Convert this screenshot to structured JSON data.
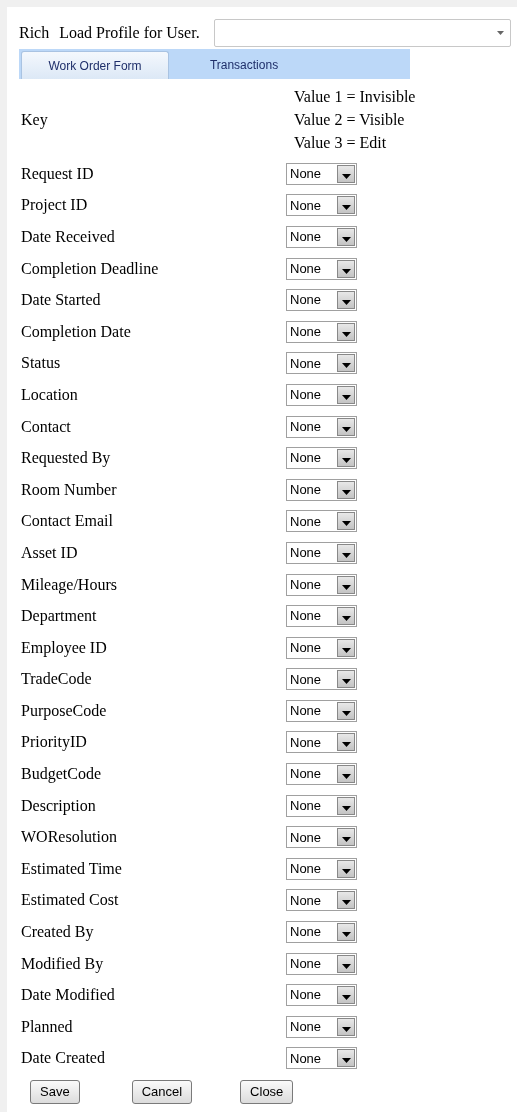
{
  "header": {
    "user": "Rich",
    "label": "Load Profile for User."
  },
  "tabs": [
    {
      "label": "Work Order Form",
      "selected": true
    },
    {
      "label": "Transactions",
      "selected": false
    }
  ],
  "key": {
    "label": "Key",
    "lines": [
      "Value 1 = Invisible",
      "Value 2 = Visible",
      "Value 3 = Edit"
    ]
  },
  "fields": [
    {
      "label": "Request ID",
      "value": "None"
    },
    {
      "label": "Project ID",
      "value": "None"
    },
    {
      "label": "Date Received",
      "value": "None"
    },
    {
      "label": "Completion Deadline",
      "value": "None"
    },
    {
      "label": "Date Started",
      "value": "None"
    },
    {
      "label": "Completion Date",
      "value": "None"
    },
    {
      "label": "Status",
      "value": "None"
    },
    {
      "label": "Location",
      "value": "None"
    },
    {
      "label": "Contact",
      "value": "None"
    },
    {
      "label": "Requested By",
      "value": "None"
    },
    {
      "label": "Room Number",
      "value": "None"
    },
    {
      "label": "Contact Email",
      "value": "None"
    },
    {
      "label": "Asset ID",
      "value": "None"
    },
    {
      "label": "Mileage/Hours",
      "value": "None"
    },
    {
      "label": "Department",
      "value": "None"
    },
    {
      "label": "Employee ID",
      "value": "None"
    },
    {
      "label": "TradeCode",
      "value": "None"
    },
    {
      "label": "PurposeCode",
      "value": "None"
    },
    {
      "label": "PriorityID",
      "value": "None"
    },
    {
      "label": "BudgetCode",
      "value": "None"
    },
    {
      "label": "Description",
      "value": "None"
    },
    {
      "label": "WOResolution",
      "value": "None"
    },
    {
      "label": "Estimated Time",
      "value": "None"
    },
    {
      "label": "Estimated Cost",
      "value": "None"
    },
    {
      "label": "Created By",
      "value": "None"
    },
    {
      "label": "Modified By",
      "value": "None"
    },
    {
      "label": "Date Modified",
      "value": "None"
    },
    {
      "label": "Planned",
      "value": "None"
    },
    {
      "label": "Date Created",
      "value": "None"
    }
  ],
  "buttons": [
    "Save",
    "Cancel",
    "Close"
  ]
}
